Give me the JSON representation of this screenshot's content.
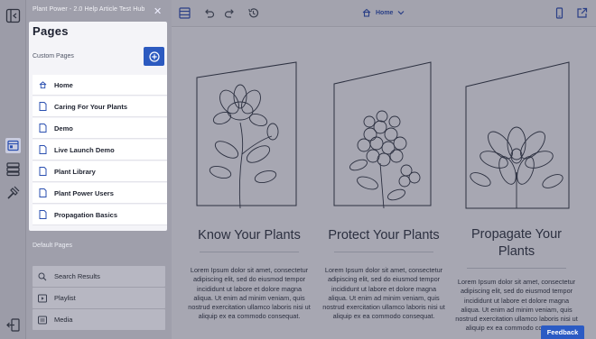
{
  "header": {
    "app_title": "Plant Power - 2.0 Help Article Test Hub"
  },
  "custom_pages": {
    "title": "Pages",
    "subtitle": "Custom Pages",
    "items": [
      {
        "label": "Home",
        "icon": "home-icon"
      },
      {
        "label": "Caring For Your Plants",
        "icon": "page-icon"
      },
      {
        "label": "Demo",
        "icon": "page-icon"
      },
      {
        "label": "Live Launch Demo",
        "icon": "page-icon"
      },
      {
        "label": "Plant Library",
        "icon": "page-icon"
      },
      {
        "label": "Plant Power Users",
        "icon": "page-icon"
      },
      {
        "label": "Propagation Basics",
        "icon": "page-icon"
      }
    ]
  },
  "default_pages": {
    "title": "Default Pages",
    "items": [
      {
        "label": "Search Results",
        "icon": "search-icon"
      },
      {
        "label": "Playlist",
        "icon": "playlist-icon"
      },
      {
        "label": "Media",
        "icon": "media-icon"
      }
    ]
  },
  "toolbar": {
    "page_selector": "Home"
  },
  "cards": [
    {
      "title": "Know Your Plants",
      "body": "Lorem Ipsum dolor sit amet, consectetur adipiscing elit, sed do eiusmod tempor incididunt ut labore et dolore magna aliqua. Ut enim ad minim veniam, quis nostrud exercitation ullamco laboris nisi ut aliquip ex ea commodo consequat."
    },
    {
      "title": "Protect Your Plants",
      "body": "Lorem Ipsum dolor sit amet, consectetur adipiscing elit, sed do eiusmod tempor incididunt ut labore et dolore magna aliqua. Ut enim ad minim veniam, quis nostrud exercitation ullamco laboris nisi ut aliquip ex ea commodo consequat."
    },
    {
      "title": "Propagate Your Plants",
      "body": "Lorem Ipsum dolor sit amet, consectetur adipiscing elit, sed do eiusmod tempor incididunt ut labore et dolore magna aliqua. Ut enim ad minim veniam, quis nostrud exercitation ullamco laboris nisi ut aliquip ex ea commodo consequat."
    }
  ],
  "feedback": {
    "label": "Feedback"
  },
  "colors": {
    "accent": "#2c5ac0",
    "panel": "#f4f4f8",
    "overlay": "#a7a7b2"
  }
}
